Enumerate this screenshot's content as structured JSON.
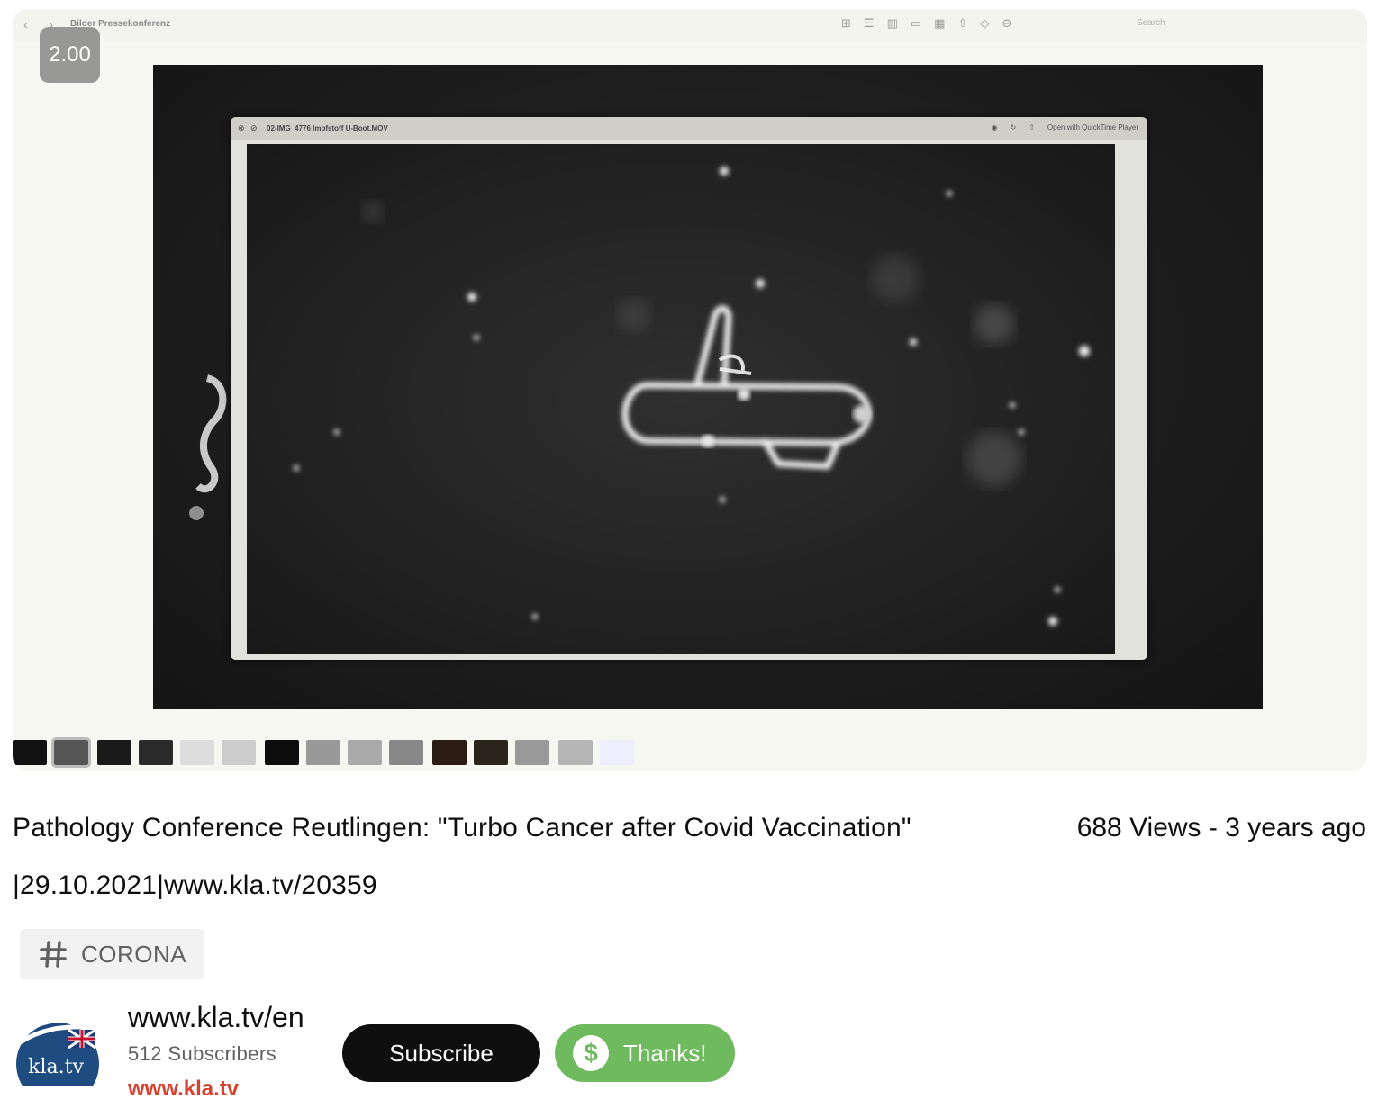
{
  "player": {
    "speed_badge": "2.00",
    "finder": {
      "nav": "‹ ›",
      "folder_title": "Bilder Pressekonferenz",
      "search_placeholder": "Search"
    },
    "quicktime": {
      "file_title": "02-IMG_4776 Impfstoff U-Boot.MOV",
      "open_with": "Open with QuickTime Player"
    }
  },
  "video": {
    "title": "Pathology Conference Reutlingen: \"Turbo Cancer after Covid Vaccination\" |29.10.2021|www.kla.tv/20359",
    "views": "688 Views - 3 years ago"
  },
  "tag": {
    "label": "CORONA",
    "icon": "hashtag-icon"
  },
  "channel": {
    "name": "www.kla.tv/en",
    "subscribers": "512 Subscribers",
    "link": "www.kla.tv",
    "avatar_text": "kla.tv"
  },
  "actions": {
    "subscribe_label": "Subscribe",
    "thanks_label": "Thanks!",
    "thanks_icon": "dollar-icon"
  },
  "colors": {
    "channel_link": "#d9412e",
    "thanks_button": "#6fb95f",
    "subscribe_button": "#0f0f0f"
  }
}
